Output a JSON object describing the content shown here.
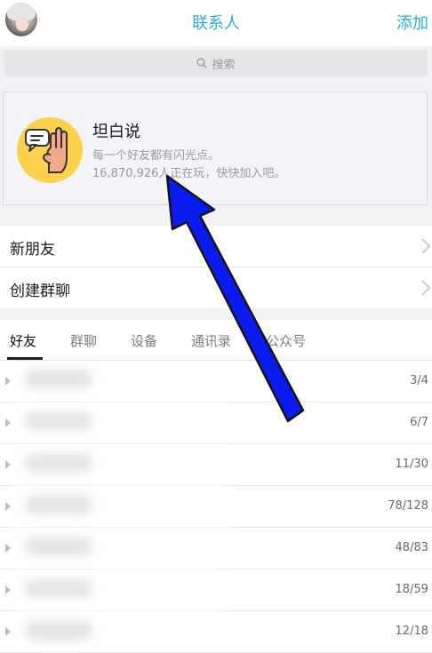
{
  "header": {
    "title": "联系人",
    "add_label": "添加"
  },
  "search": {
    "placeholder": "搜索"
  },
  "promo_card": {
    "title": "坦白说",
    "subtitle": "每一个好友都有闪光点。",
    "player_count_text": "16,870,926人正在玩，快快加入吧。"
  },
  "menu": {
    "new_friends": "新朋友",
    "create_group_chat": "创建群聊"
  },
  "tabs": [
    {
      "label": "好友",
      "active": true
    },
    {
      "label": "群聊",
      "active": false
    },
    {
      "label": "设备",
      "active": false
    },
    {
      "label": "通讯录",
      "active": false
    },
    {
      "label": "公众号",
      "active": false
    }
  ],
  "friend_groups": [
    {
      "count": "3/4"
    },
    {
      "count": "6/7"
    },
    {
      "count": "11/30"
    },
    {
      "count": "78/128"
    },
    {
      "count": "48/83"
    },
    {
      "count": "18/59"
    },
    {
      "count": "12/18"
    }
  ],
  "icons": {
    "avatar": "user-avatar",
    "search": "search-icon",
    "promo": "speech-bubble-hand-icon",
    "chevron": "chevron-right-icon",
    "group_toggle": "triangle-right-icon",
    "annotation": "blue-arrow-annotation"
  },
  "colors": {
    "accent": "#2ab0d8",
    "promo_icon_bg": "#fdd04f",
    "annotation_arrow": "#0a1bf0"
  }
}
